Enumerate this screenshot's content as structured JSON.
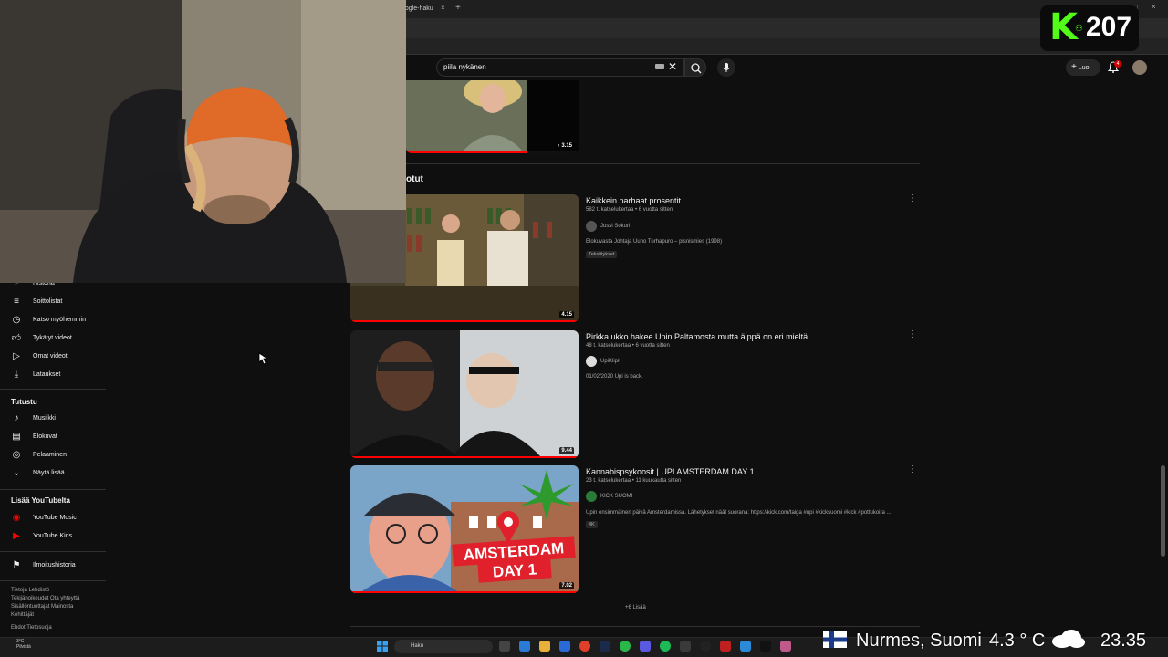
{
  "browser": {
    "tab_title": "oogle-haku",
    "tab_close": "×",
    "new_tab": "+"
  },
  "header": {
    "search_query": "piila nykänen",
    "create_label": "Luo",
    "notification_count": "4"
  },
  "kick_overlay": {
    "logo_letter": "K",
    "viewer_count": "207",
    "accent": "#53fc18"
  },
  "sidebar": {
    "items_top": [
      {
        "label": "Historia",
        "icon": "history-icon"
      },
      {
        "label": "Soittolistat",
        "icon": "playlist-icon"
      },
      {
        "label": "Katso myöhemmin",
        "icon": "clock-icon"
      },
      {
        "label": "Tykätyt videot",
        "icon": "thumbs-up-icon"
      },
      {
        "label": "Omat videot",
        "icon": "play-square-icon"
      },
      {
        "label": "Lataukset",
        "icon": "download-icon"
      }
    ],
    "explore_heading": "Tutustu",
    "explore_items": [
      {
        "label": "Musiikki",
        "icon": "music-icon"
      },
      {
        "label": "Elokuvat",
        "icon": "film-icon"
      },
      {
        "label": "Pelaaminen",
        "icon": "gamepad-icon"
      },
      {
        "label": "Näytä lisää",
        "icon": "chevron-down-icon"
      }
    ],
    "more_heading": "Lisää YouTubelta",
    "more_items": [
      {
        "label": "YouTube Music",
        "icon": "youtube-music-icon"
      },
      {
        "label": "YouTube Kids",
        "icon": "youtube-kids-icon"
      }
    ],
    "report_item": {
      "label": "Ilmoitushistoria",
      "icon": "flag-icon"
    },
    "footer_1": "Tietoja  Lehdistö",
    "footer_2": "Tekijänoikeudet  Ota yhteyttä",
    "footer_3": "Sisällöntuottajat  Mainosta",
    "footer_4": "Kehittäjät",
    "footer_5": "Ehdot  Tietosuoja"
  },
  "main": {
    "top_video_duration": "3.15",
    "section_title": "otut",
    "videos": [
      {
        "title": "Kaikkein parhaat prosentit",
        "meta": "582 t. katselukertaa • 6 vuotta sitten",
        "channel": "Jussi Sokuri",
        "description": "Elokuvasta Johtaja Uuno Turhapuro – pisnismies (1998)",
        "badge": "Tekstitykset",
        "duration": "4.15"
      },
      {
        "title": "Pirkka ukko hakee Upin Paltamosta mutta äippä on eri mieltä",
        "meta": "48 t. katselukertaa • 6 vuotta sitten",
        "channel": "UpiKlipit",
        "description": "01/02/2020 Upi is back.",
        "badge": "",
        "duration": "9.44"
      },
      {
        "title": "Kannabispsykoosit | UPI AMSTERDAM DAY 1",
        "meta": "23 t. katselukertaa • 11 kuukautta sitten",
        "channel": "KICK SUOMI",
        "description": "Upin ensimmäinen päivä Amsterdamissa. Lähetykset näät suorana: https://kick.com/taiga #upi #kicksuomi #kick #pottukoira ...",
        "badge": "4K",
        "duration": "7.02",
        "thumb_text_1": "AMSTERDAM",
        "thumb_text_2": "DAY 1"
      }
    ],
    "more_label": "+6 Lisää"
  },
  "taskbar": {
    "weather_temp": "3°C",
    "weather_desc": "Pilvistä",
    "search_placeholder": "Haku"
  },
  "stream_overlay": {
    "location": "Nurmes, Suomi",
    "temperature": "4.3 ° C",
    "time": "23.35"
  }
}
